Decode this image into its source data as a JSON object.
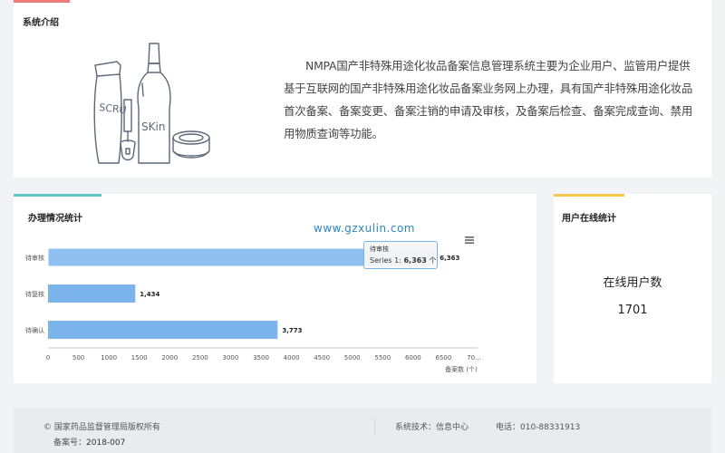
{
  "intro": {
    "title": "系统介绍",
    "text": "NMPA国产非特殊用途化妆品备案信息管理系统主要为企业用户、监管用户提供基于互联网的国产非特殊用途化妆品备案业务网上办理，具有国产非特殊用途化妆品首次备案、备案变更、备案注销的申请及审核，及备案后检查、备案完成查询、禁用用物质查询等功能。",
    "illustration_labels": [
      "SCRU",
      "SKin"
    ]
  },
  "stats": {
    "title": "办理情况统计",
    "watermark": "www.gzxulin.com",
    "menu_icon": "hamburger-menu-icon",
    "tooltip": {
      "category": "待审核",
      "series_prefix": "Series 1: ",
      "value": "6,363",
      "unit": " 个"
    }
  },
  "chart_data": {
    "type": "bar",
    "orientation": "horizontal",
    "categories": [
      "待审核",
      "待复核",
      "待确认"
    ],
    "series": [
      {
        "values": [
          6363,
          1434,
          3773
        ]
      }
    ],
    "data_labels": [
      "6,363",
      "1,434",
      "3,773"
    ],
    "x_ticks": [
      "0",
      "500",
      "1000",
      "1500",
      "2000",
      "2500",
      "3000",
      "3500",
      "4000",
      "4500",
      "5000",
      "5500",
      "6000",
      "6500",
      "70..."
    ],
    "xlabel": "备案数 (个)",
    "xlim": [
      0,
      7000
    ],
    "grid": false,
    "bar_color": "#7cb5ec",
    "highlight_color": "#8fc0f0"
  },
  "online": {
    "title": "用户在线统计",
    "label": "在线用户数",
    "value": "1701"
  },
  "footer": {
    "copyright": "© 国家药品监督管理局版权所有",
    "icp_prefix": "备案号：",
    "icp_number": "2018-007",
    "tech": "系统技术：信息中心",
    "phone": "电话：010-88331913"
  },
  "colors": {
    "intro_accent": "#f07b7b",
    "stats_accent": "#5ec7c7",
    "online_accent": "#f5c84c",
    "watermark": "#2e86c1"
  }
}
